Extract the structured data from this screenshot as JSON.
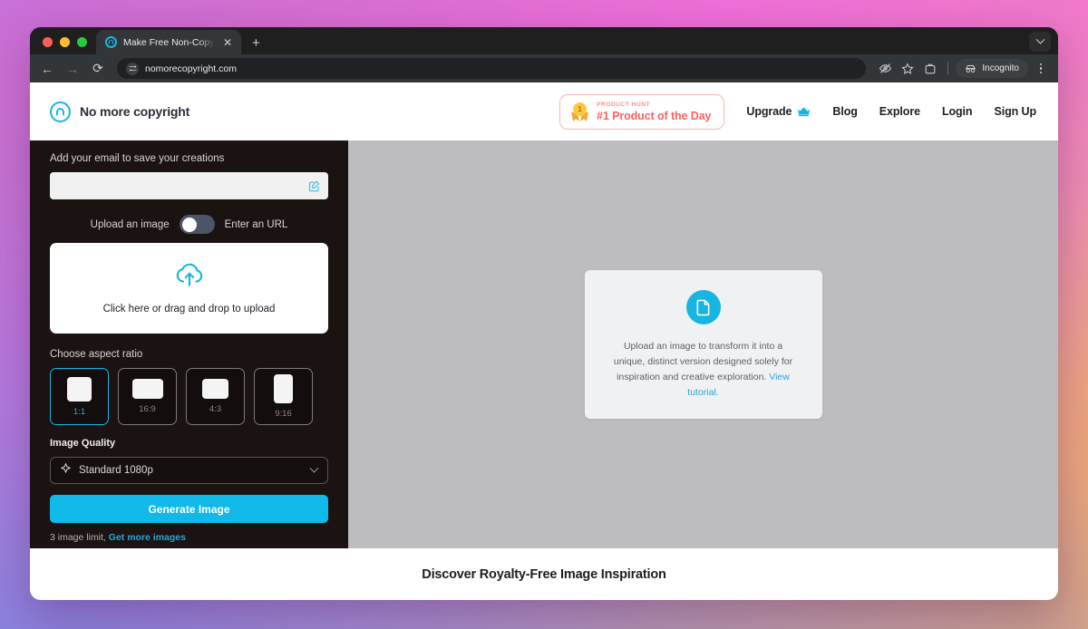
{
  "browser": {
    "tab": {
      "title": "Make Free Non-Copyright Ima",
      "close_label": "✕"
    },
    "newtab_label": "+",
    "back_label": "←",
    "forward_label": "→",
    "reload_label": "⟳",
    "url": "nomorecopyright.com",
    "incognito_label": "Incognito"
  },
  "header": {
    "brand": "No more copyright",
    "product_hunt": {
      "eyebrow": "PRODUCT HUNT",
      "title": "#1 Product of the Day",
      "rank": "1"
    },
    "nav": [
      {
        "label": "Upgrade",
        "icon": "crown-icon"
      },
      {
        "label": "Blog"
      },
      {
        "label": "Explore"
      },
      {
        "label": "Login"
      },
      {
        "label": "Sign Up"
      }
    ]
  },
  "sidebar": {
    "email_label": "Add your email to save your creations",
    "email_value": "",
    "email_placeholder": "",
    "toggle": {
      "left_label": "Upload an image",
      "right_label": "Enter an URL",
      "state": "left"
    },
    "dropzone_text": "Click here or drag and drop to upload",
    "aspect_label": "Choose aspect ratio",
    "aspect_options": [
      {
        "label": "1:1",
        "selected": true
      },
      {
        "label": "16:9",
        "selected": false
      },
      {
        "label": "4:3",
        "selected": false
      },
      {
        "label": "9:16",
        "selected": false
      }
    ],
    "quality_label": "Image Quality",
    "quality_value": "Standard 1080p",
    "generate_label": "Generate Image",
    "limit_text": "3 image limit,",
    "limit_link": "Get more images"
  },
  "canvas": {
    "empty_text": "Upload an image to transform it into a unique, distinct version designed solely for inspiration and creative exploration.",
    "empty_link": "View tutorial."
  },
  "footer": {
    "heading": "Discover Royalty-Free Image Inspiration"
  },
  "colors": {
    "accent": "#18b5e3",
    "generate_button": "#11b9e8",
    "sidebar_bg": "#1a1312",
    "canvas_bg": "#bdbdc1",
    "ph_red": "#ff5f5f"
  }
}
